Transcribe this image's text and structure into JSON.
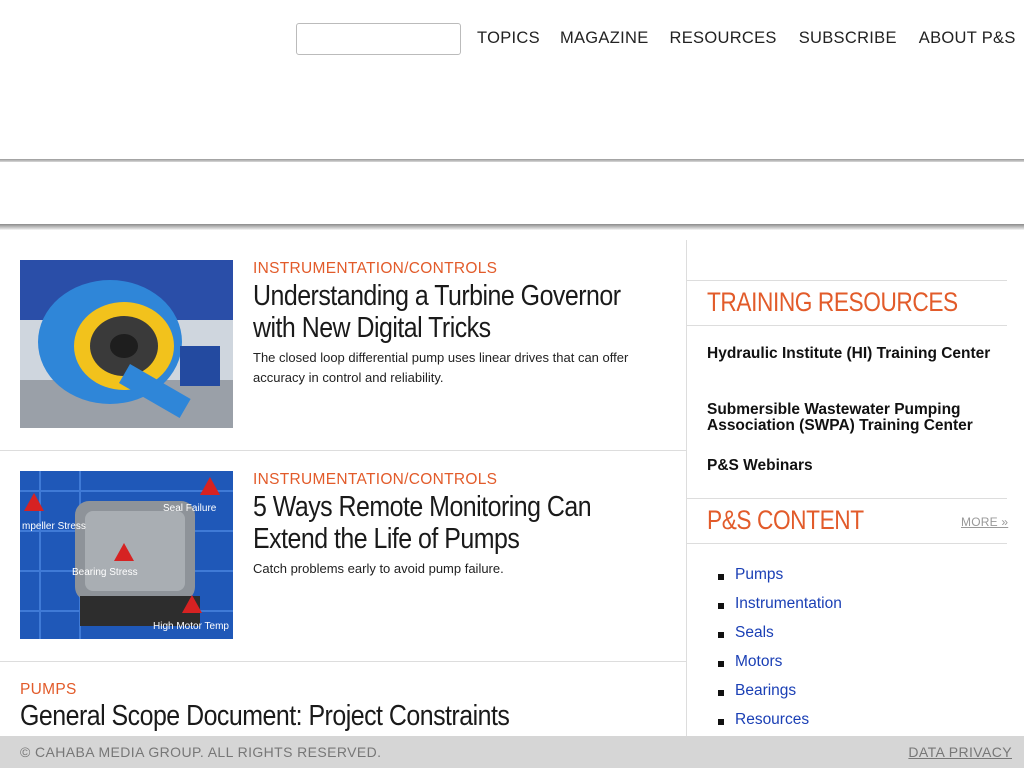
{
  "search": {
    "placeholder": ""
  },
  "nav": {
    "items": [
      "TOPICS",
      "MAGAZINE",
      "RESOURCES",
      "SUBSCRIBE",
      "ABOUT P&S"
    ]
  },
  "articles": [
    {
      "category": "INSTRUMENTATION/CONTROLS",
      "title_line1": "Understanding a Turbine Governor",
      "title_line2": "with New Digital Tricks",
      "description": "The closed loop differential pump uses linear drives that can offer accuracy in control and reliability."
    },
    {
      "category": "INSTRUMENTATION/CONTROLS",
      "title_line1": "5 Ways Remote Monitoring Can",
      "title_line2": "Extend the Life of Pumps",
      "description": "Catch problems early to avoid pump failure.",
      "image_labels": [
        "mpeller Stress",
        "Seal Failure",
        "Bearing Stress",
        "High Motor Temp"
      ]
    },
    {
      "category": "PUMPS",
      "title": "General Scope Document: Project Constraints"
    }
  ],
  "sidebar": {
    "training": {
      "heading": "TRAINING RESOURCES",
      "links": [
        "Hydraulic Institute (HI) Training Center",
        "Submersible Wastewater Pumping Association (SWPA) Training Center",
        "P&S Webinars"
      ]
    },
    "content": {
      "heading": "P&S CONTENT",
      "more_label": "MORE »",
      "items": [
        "Pumps",
        "Instrumentation",
        "Seals",
        "Motors",
        "Bearings",
        "Resources"
      ]
    }
  },
  "footer": {
    "copyright": "© CAHABA MEDIA GROUP. ALL RIGHTS RESERVED.",
    "privacy": "DATA PRIVACY"
  },
  "colors": {
    "accent": "#e25b2a",
    "link": "#1a3fb5",
    "footer_bg": "#d6d6d6"
  }
}
